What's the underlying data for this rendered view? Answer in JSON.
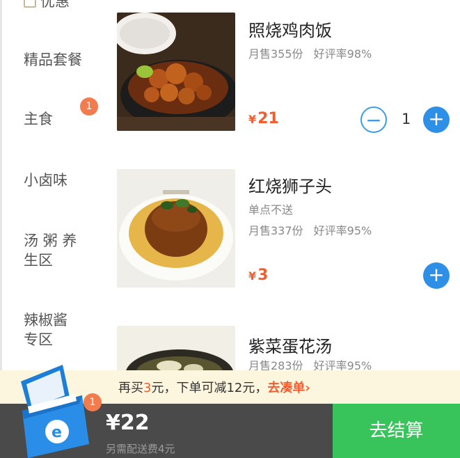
{
  "sidebar": {
    "top_partial_label": "优惠",
    "categories": [
      {
        "label": "精品套餐"
      },
      {
        "label": "主食",
        "badge": "1"
      },
      {
        "label": "小卤味"
      },
      {
        "label_line1": "汤 粥 养",
        "label_line2": "生区"
      },
      {
        "label_line1": "辣椒酱",
        "label_line2": "专区"
      }
    ]
  },
  "products": [
    {
      "name": "照烧鸡肉饭",
      "monthly_sales": "月售355份",
      "rating": "好评率98%",
      "price_symbol": "¥",
      "price": "21",
      "quantity": "1",
      "minus_icon": "minus-circle-icon",
      "plus_icon": "plus-circle-icon"
    },
    {
      "name": "红烧狮子头",
      "note": "单点不送",
      "monthly_sales": "月售337份",
      "rating": "好评率95%",
      "price_symbol": "¥",
      "price": "3",
      "plus_icon": "plus-circle-icon"
    },
    {
      "name": "紫菜蛋花汤",
      "monthly_sales": "月售283份",
      "rating": "好评率95%"
    }
  ],
  "promo": {
    "prefix": "再买",
    "amount": "3",
    "middle": "元，下单可减12元，",
    "link": "去凑单",
    "chevron": "›"
  },
  "cart": {
    "badge": "1",
    "total": "¥22",
    "delivery_note": "另需配送费4元",
    "checkout_label": "去结算"
  },
  "colors": {
    "accent_blue": "#2d8fe6",
    "price_red": "#f25c2f",
    "checkout_green": "#39c45b",
    "bar_dark": "#4a4a4a",
    "promo_bg": "#fdf6df"
  }
}
